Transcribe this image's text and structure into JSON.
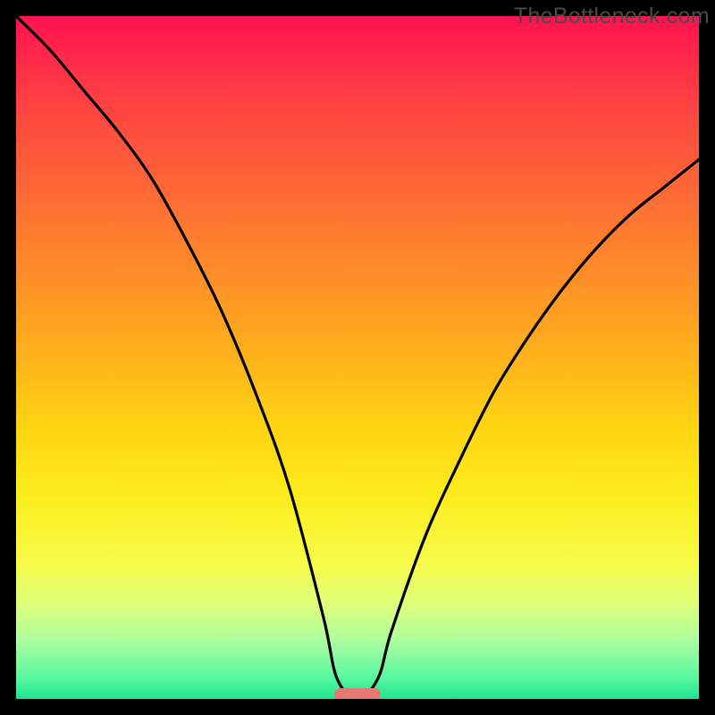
{
  "watermark": "TheBottleneck.com",
  "colors": {
    "frame": "#000000",
    "line": "#000000",
    "marker": "#e47a72"
  },
  "chart_data": {
    "type": "line",
    "title": "",
    "xlabel": "",
    "ylabel": "",
    "xlim": [
      0,
      100
    ],
    "ylim": [
      0,
      100
    ],
    "x": [
      0,
      5,
      10,
      15,
      20,
      25,
      30,
      35,
      40,
      45,
      47,
      50,
      53,
      55,
      60,
      65,
      70,
      75,
      80,
      85,
      90,
      95,
      100
    ],
    "values": [
      100,
      95,
      89,
      83,
      76,
      67,
      57,
      45,
      31,
      12,
      3,
      0,
      3,
      10,
      24,
      35,
      45,
      53,
      60,
      66,
      71,
      75,
      79
    ],
    "marker_x": 50,
    "series": [
      {
        "name": "bottleneck-curve",
        "values": [
          100,
          95,
          89,
          83,
          76,
          67,
          57,
          45,
          31,
          12,
          3,
          0,
          3,
          10,
          24,
          35,
          45,
          53,
          60,
          66,
          71,
          75,
          79
        ]
      }
    ]
  }
}
